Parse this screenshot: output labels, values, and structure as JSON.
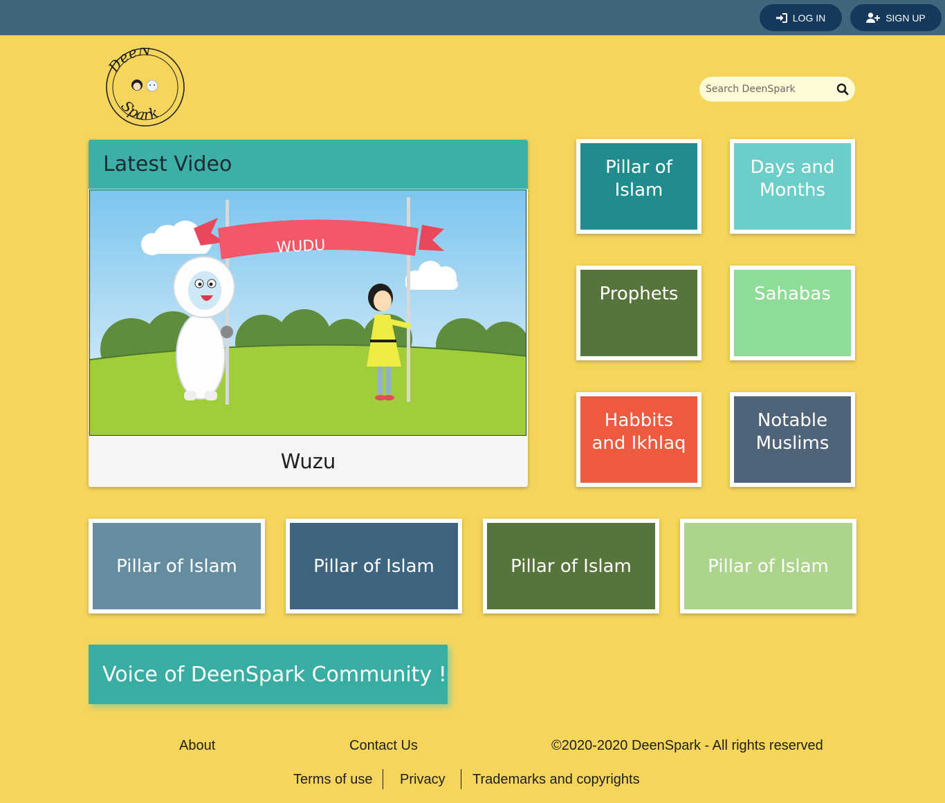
{
  "auth": {
    "login_label": "LOG IN",
    "signup_label": "SIGN UP"
  },
  "brand": {
    "logo_text_top": "DeeN",
    "logo_text_bottom": "Spark"
  },
  "search": {
    "placeholder": "Search DeenSpark"
  },
  "latest_video": {
    "heading": "Latest Video",
    "banner_text": "WUDU",
    "title": "Wuzu"
  },
  "categories": [
    {
      "label": "Pillar of Islam",
      "color": "#218c8d"
    },
    {
      "label": "Days and Months",
      "color": "#6ccdc9"
    },
    {
      "label": "Prophets",
      "color": "#57743c"
    },
    {
      "label": "Sahabas",
      "color": "#8fdb98"
    },
    {
      "label": "Habbits and Ikhlaq",
      "color": "#ee5a3d"
    },
    {
      "label": "Notable Muslims",
      "color": "#4f6478"
    }
  ],
  "featured": [
    {
      "label": "Pillar of Islam",
      "color": "#658d9f"
    },
    {
      "label": "Pillar of Islam",
      "color": "#3e6480"
    },
    {
      "label": "Pillar of Islam",
      "color": "#57743c"
    },
    {
      "label": "Pillar of Islam",
      "color": "#acd48d"
    }
  ],
  "community": {
    "label": "Voice of DeenSpark Community !"
  },
  "footer": {
    "about": "About",
    "contact": "Contact Us",
    "copyright": "©2020-2020 DeenSpark - All rights reserved",
    "terms": "Terms of use",
    "privacy": "Privacy",
    "trademarks": "Trademarks and copyrights"
  }
}
